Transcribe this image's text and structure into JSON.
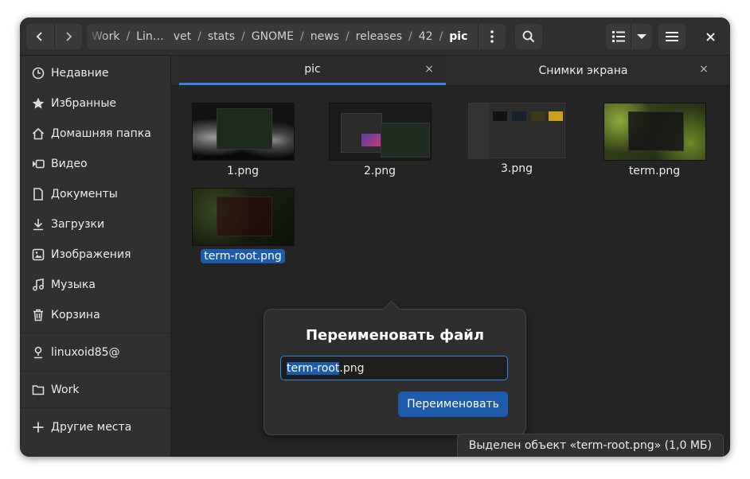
{
  "window": {
    "pathbar": {
      "segments": [
        "Work",
        "Lin…",
        "vet",
        "stats",
        "GNOME",
        "news",
        "releases",
        "42",
        "pic"
      ],
      "separator": "/"
    },
    "close_glyph": "×"
  },
  "sidebar": {
    "items": [
      {
        "label": "Недавние",
        "icon": "clock-icon"
      },
      {
        "label": "Избранные",
        "icon": "star-icon"
      },
      {
        "label": "Домашняя папка",
        "icon": "home-icon"
      },
      {
        "label": "Видео",
        "icon": "video-icon"
      },
      {
        "label": "Документы",
        "icon": "document-icon"
      },
      {
        "label": "Загрузки",
        "icon": "download-icon"
      },
      {
        "label": "Изображения",
        "icon": "image-icon"
      },
      {
        "label": "Музыка",
        "icon": "music-icon"
      },
      {
        "label": "Корзина",
        "icon": "trash-icon"
      },
      {
        "label": "linuxoid85@",
        "icon": "user-icon"
      },
      {
        "label": "Work",
        "icon": "folder-icon"
      },
      {
        "label": "Другие места",
        "icon": "plus-icon"
      }
    ]
  },
  "tabs": [
    {
      "label": "pic",
      "active": true,
      "close": "×"
    },
    {
      "label": "Снимки экрана",
      "active": false,
      "close": "×"
    }
  ],
  "files": [
    {
      "name": "1.png",
      "selected": false
    },
    {
      "name": "2.png",
      "selected": false
    },
    {
      "name": "3.png",
      "selected": false
    },
    {
      "name": "term.png",
      "selected": false
    },
    {
      "name": "term-root.png",
      "selected": true
    }
  ],
  "rename_dialog": {
    "title": "Переименовать файл",
    "input_highlighted": "term-root",
    "input_rest": ".png",
    "button_label": "Переименовать"
  },
  "statusbar": {
    "text": "Выделен объект «term-root.png»  (1,0 МБ)"
  },
  "colors": {
    "accent": "#3584e4",
    "selection": "#1c5cab",
    "window_bg": "#2a2a2a"
  }
}
